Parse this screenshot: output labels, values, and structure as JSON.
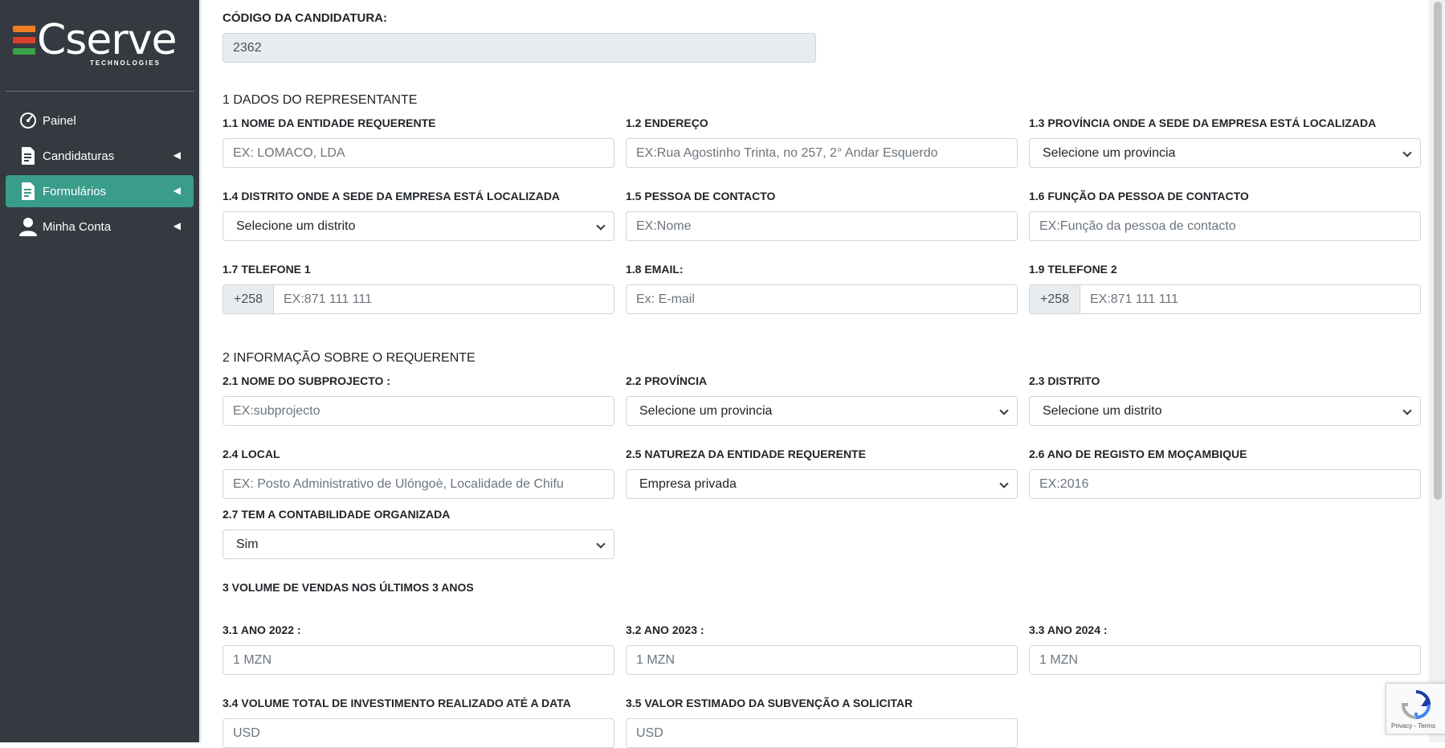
{
  "brand": {
    "name": "Cserve",
    "tagline": "TECHNOLOGIES",
    "colors": {
      "orange": "#ef7d22",
      "red": "#d8402b",
      "green": "#3aa348"
    }
  },
  "sidebar": {
    "items": [
      {
        "label": "Painel",
        "icon": "gauge-icon"
      },
      {
        "label": "Candidaturas",
        "icon": "document-icon"
      },
      {
        "label": "Formulários",
        "icon": "document-icon",
        "active": true
      },
      {
        "label": "Minha Conta",
        "icon": "user-icon"
      }
    ],
    "active_color": "#3a9c8b"
  },
  "form": {
    "code_label": "CÓDIGO DA CANDIDATURA:",
    "code_value": "2362",
    "s1": {
      "title": "1 DADOS DO REPRESENTANTE",
      "f11": {
        "label": "1.1 NOME DA ENTIDADE REQUERENTE",
        "placeholder": "EX: LOMACO, LDA"
      },
      "f12": {
        "label": "1.2 ENDEREÇO",
        "placeholder": "EX:Rua Agostinho Trinta, no 257, 2° Andar Esquerdo"
      },
      "f13": {
        "label": "1.3 PROVÍNCIA ONDE A SEDE DA EMPRESA ESTÁ LOCALIZADA",
        "value": "Selecione um provincia"
      },
      "f14": {
        "label": "1.4 DISTRITO ONDE A SEDE DA EMPRESA ESTÁ LOCALIZADA",
        "value": "Selecione um distrito"
      },
      "f15": {
        "label": "1.5 PESSOA DE CONTACTO",
        "placeholder": "EX:Nome"
      },
      "f16": {
        "label": "1.6 FUNÇÃO DA PESSOA DE CONTACTO",
        "placeholder": "EX:Função da pessoa de contacto"
      },
      "f17": {
        "label": "1.7 TELEFONE 1",
        "prefix": "+258",
        "placeholder": "EX:871 111 111"
      },
      "f18": {
        "label": "1.8 EMAIL:",
        "placeholder": "Ex: E-mail"
      },
      "f19": {
        "label": "1.9 TELEFONE 2",
        "prefix": "+258",
        "placeholder": "EX:871 111 111"
      }
    },
    "s2": {
      "title": "2 INFORMAÇÃO SOBRE O REQUERENTE",
      "f21": {
        "label": "2.1 NOME DO SUBPROJECTO :",
        "placeholder": "EX:subprojecto"
      },
      "f22": {
        "label": "2.2 PROVÍNCIA",
        "value": "Selecione um provincia"
      },
      "f23": {
        "label": "2.3 DISTRITO",
        "value": "Selecione um distrito"
      },
      "f24": {
        "label": "2.4 LOCAL",
        "placeholder": "EX: Posto Administrativo de Ulóngoè, Localidade de Chifu"
      },
      "f25": {
        "label": "2.5 NATUREZA DA ENTIDADE REQUERENTE",
        "value": "Empresa privada"
      },
      "f26": {
        "label": "2.6 ANO DE REGISTO EM MOÇAMBIQUE",
        "placeholder": "EX:2016"
      },
      "f27": {
        "label": "2.7 TEM A CONTABILIDADE ORGANIZADA",
        "value": "Sim"
      }
    },
    "s3": {
      "title": "3 VOLUME DE VENDAS NOS ÚLTIMOS 3 ANOS",
      "f31": {
        "label": "3.1 ANO 2022 :",
        "placeholder": "1 MZN"
      },
      "f32": {
        "label": "3.2 ANO 2023 :",
        "placeholder": "1 MZN"
      },
      "f33": {
        "label": "3.3 ANO 2024 :",
        "placeholder": "1 MZN"
      },
      "f34": {
        "label": "3.4 VOLUME TOTAL DE INVESTIMENTO REALIZADO ATÉ A DATA",
        "placeholder": "USD"
      },
      "f35": {
        "label": "3.5 VALOR ESTIMADO DA SUBVENÇÃO A SOLICITAR",
        "placeholder": "USD"
      }
    }
  },
  "recaptcha": {
    "text": "Privacy - Terms"
  }
}
